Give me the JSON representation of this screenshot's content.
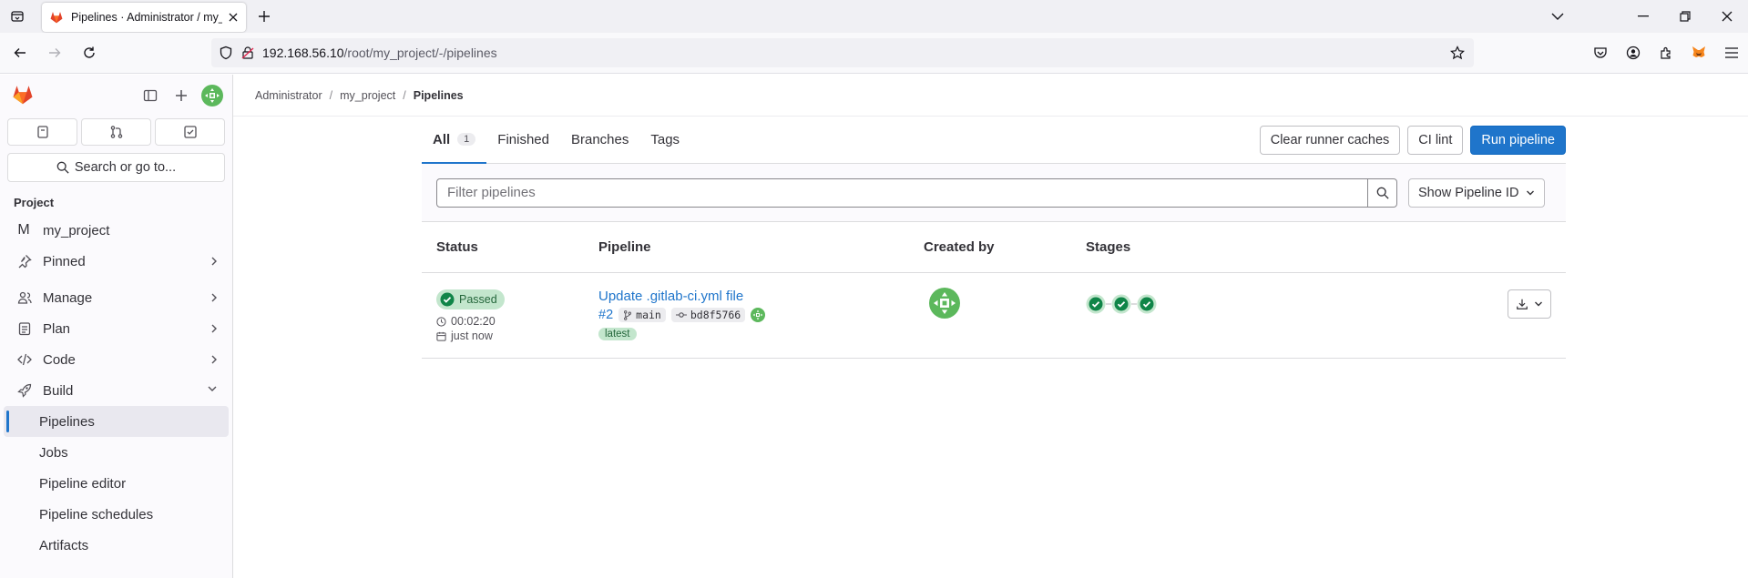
{
  "browser": {
    "tab_title": "Pipelines · Administrator / my_p",
    "url_host": "192.168.56.10",
    "url_path": "/root/my_project/-/pipelines"
  },
  "sidebar": {
    "search_label": "Search or go to...",
    "section_label": "Project",
    "project_initial": "M",
    "project_name": "my_project",
    "items": [
      {
        "label": "Pinned"
      },
      {
        "label": "Manage"
      },
      {
        "label": "Plan"
      },
      {
        "label": "Code"
      },
      {
        "label": "Build"
      }
    ],
    "build_sub": [
      "Pipelines",
      "Jobs",
      "Pipeline editor",
      "Pipeline schedules",
      "Artifacts"
    ]
  },
  "breadcrumbs": [
    "Administrator",
    "my_project",
    "Pipelines"
  ],
  "tabs": [
    {
      "label": "All",
      "count": "1"
    },
    {
      "label": "Finished"
    },
    {
      "label": "Branches"
    },
    {
      "label": "Tags"
    }
  ],
  "actions": {
    "clear_cache": "Clear runner caches",
    "ci_lint": "CI lint",
    "run_pipeline": "Run pipeline"
  },
  "filter": {
    "placeholder": "Filter pipelines",
    "id_select": "Show Pipeline ID"
  },
  "table": {
    "headers": [
      "Status",
      "Pipeline",
      "Created by",
      "Stages"
    ],
    "rows": [
      {
        "status": "Passed",
        "duration": "00:02:20",
        "finished": "just now",
        "title": "Update .gitlab-ci.yml file",
        "id": "#2",
        "branch": "main",
        "commit": "bd8f5766",
        "tag": "latest"
      }
    ]
  },
  "colors": {
    "primary": "#1f75cb",
    "success": "#108548",
    "success_bg": "#c3e6cd",
    "gitlab_orange": "#e24329"
  }
}
